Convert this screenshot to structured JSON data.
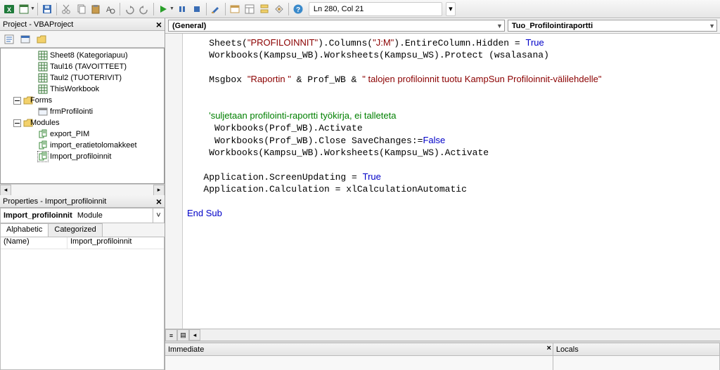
{
  "status": {
    "location": "Ln 280, Col 21"
  },
  "projectPane": {
    "title": "Project - VBAProject",
    "items": [
      {
        "indent": 48,
        "icon": "sheet",
        "label": "Sheet8 (Kategoriapuu)"
      },
      {
        "indent": 48,
        "icon": "sheet",
        "label": "Taul16 (TAVOITTEET)"
      },
      {
        "indent": 48,
        "icon": "sheet",
        "label": "Taul2 (TUOTERIVIT)"
      },
      {
        "indent": 48,
        "icon": "sheet",
        "label": "ThisWorkbook"
      },
      {
        "indent": 20,
        "icon": "minus-folder",
        "label": "Forms"
      },
      {
        "indent": 48,
        "icon": "form",
        "label": "frmProfilointi"
      },
      {
        "indent": 20,
        "icon": "minus-folder",
        "label": "Modules"
      },
      {
        "indent": 48,
        "icon": "module",
        "label": "export_PIM"
      },
      {
        "indent": 48,
        "icon": "module",
        "label": "import_eratietolomakkeet"
      },
      {
        "indent": 48,
        "icon": "module",
        "label": "Import_profiloinnit"
      }
    ]
  },
  "propsPane": {
    "title": "Properties - Import_profiloinnit",
    "selector": "Import_profiloinnit",
    "selectorSuffix": " Module",
    "tabs": [
      "Alphabetic",
      "Categorized"
    ],
    "rows": [
      {
        "k": "(Name)",
        "v": "Import_profiloinnit"
      }
    ]
  },
  "codePane": {
    "object": "(General)",
    "procedure": "Tuo_Profilointiraportti",
    "lines": [
      [
        "    ",
        "call:Sheets",
        [
          "str",
          "\"PROFILOINNIT\""
        ],
        ").Columns(",
        [
          "str",
          "\"J:M\""
        ],
        ").EntireColumn.Hidden = ",
        [
          "kw",
          "True"
        ]
      ],
      [
        "    ",
        "Workbooks(Kampsu_WB).Worksheets(Kampsu_WS).Protect (wsalasana)"
      ],
      [
        ""
      ],
      [
        "    ",
        "Msgbox ",
        [
          "str",
          "\"Raportin \""
        ],
        " & Prof_WB & ",
        [
          "str",
          "\" talojen profiloinnit tuotu KampSun Profiloinnit-välilehdelle\""
        ]
      ],
      [
        ""
      ],
      [
        ""
      ],
      [
        "    ",
        [
          "com",
          "'suljetaan profilointi-raportti työkirja, ei talleteta"
        ]
      ],
      [
        "     ",
        "Workbooks(Prof_WB).Activate"
      ],
      [
        "     ",
        "Workbooks(Prof_WB).Close SaveChanges:=",
        [
          "kw",
          "False"
        ]
      ],
      [
        "    ",
        "Workbooks(Kampsu_WB).Worksheets(Kampsu_WS).Activate"
      ],
      [
        ""
      ],
      [
        "   ",
        "Application.ScreenUpdating = ",
        [
          "kw",
          "True"
        ]
      ],
      [
        "   ",
        "Application.Calculation = xlCalculationAutomatic"
      ],
      [
        ""
      ],
      [
        [
          "kw",
          "End Sub"
        ]
      ]
    ]
  },
  "bottom": {
    "immediate": "Immediate",
    "locals": "Locals"
  }
}
